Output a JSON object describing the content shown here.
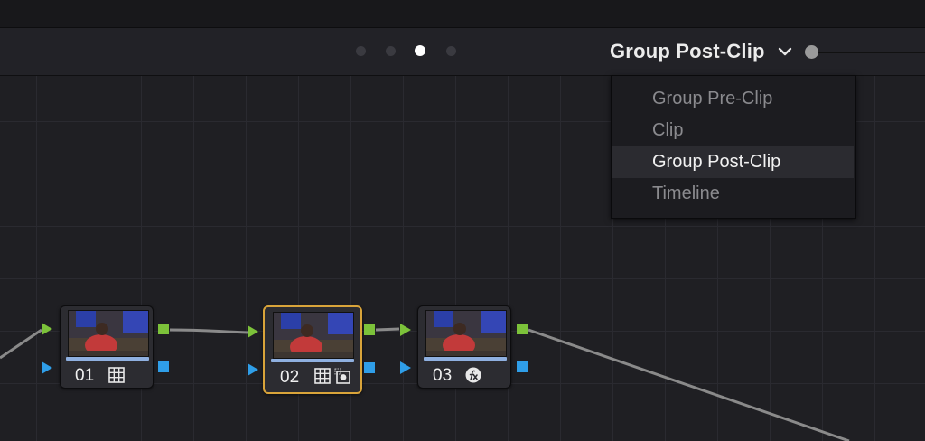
{
  "header": {
    "page_dots_count": 4,
    "active_page": 3,
    "mode_label": "Group Post-Clip"
  },
  "dropdown": {
    "items": [
      {
        "label": "Group Pre-Clip",
        "selected": false
      },
      {
        "label": "Clip",
        "selected": false
      },
      {
        "label": "Group Post-Clip",
        "selected": true
      },
      {
        "label": "Timeline",
        "selected": false
      }
    ]
  },
  "nodes": [
    {
      "number": "01",
      "icons": [
        "grid-icon"
      ],
      "selected": false
    },
    {
      "number": "02",
      "icons": [
        "grid-icon",
        "window-icon"
      ],
      "selected": true
    },
    {
      "number": "03",
      "icons": [
        "fx-icon"
      ],
      "selected": false
    }
  ],
  "colors": {
    "rgb_port": "#7cc23a",
    "alpha_port": "#2f9ee8",
    "selected_outline": "#d9a43a",
    "background": "#1f1f23"
  }
}
